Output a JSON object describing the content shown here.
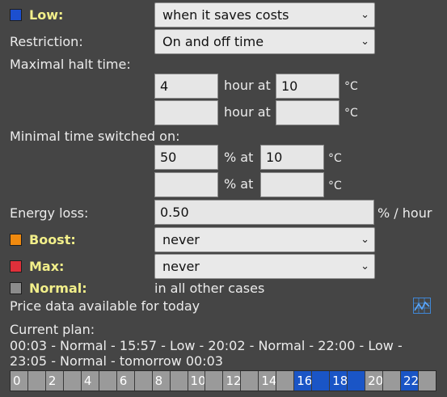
{
  "modes": {
    "low": {
      "label": "Low:",
      "color": "#1c4fcf",
      "select": "when it saves costs"
    },
    "boost": {
      "label": "Boost:",
      "color": "#f08a0f",
      "select": "never"
    },
    "max": {
      "label": "Max:",
      "color": "#e0303a",
      "select": "never"
    },
    "normal": {
      "label": "Normal:",
      "color": "#8c8c8c",
      "text": "in all other cases"
    }
  },
  "restriction": {
    "label": "Restriction:",
    "select": "On and off time"
  },
  "halt": {
    "label": "Maximal halt time:",
    "rows": [
      {
        "hours": "4",
        "at_label": "hour at",
        "temp": "10",
        "unit": "°C"
      },
      {
        "hours": "",
        "at_label": "hour at",
        "temp": "",
        "unit": "°C"
      }
    ]
  },
  "min_on": {
    "label": "Minimal time switched on:",
    "rows": [
      {
        "pct": "50",
        "at_label": "% at",
        "temp": "10",
        "unit": "°C"
      },
      {
        "pct": "",
        "at_label": "% at",
        "temp": "",
        "unit": "°C"
      }
    ]
  },
  "energy_loss": {
    "label": "Energy loss:",
    "value": "0.50",
    "unit": "% / hour"
  },
  "price_info": "Price data available for today",
  "icons": {
    "graph": "chart-icon"
  },
  "plan": {
    "label": "Current plan:",
    "line1": "00:03 - Normal - 15:57 - Low - 20:02 - Normal - 22:00 - Low -",
    "line2": "23:05 - Normal - tomorrow 00:03"
  },
  "timeline": {
    "labels": [
      "0",
      "",
      "2",
      "",
      "4",
      "",
      "6",
      "",
      "8",
      "",
      "10",
      "",
      "12",
      "",
      "14",
      "",
      "16",
      "",
      "18",
      "",
      "20",
      "",
      "22",
      ""
    ],
    "blue_hours": [
      16,
      17,
      18,
      19,
      22
    ]
  }
}
